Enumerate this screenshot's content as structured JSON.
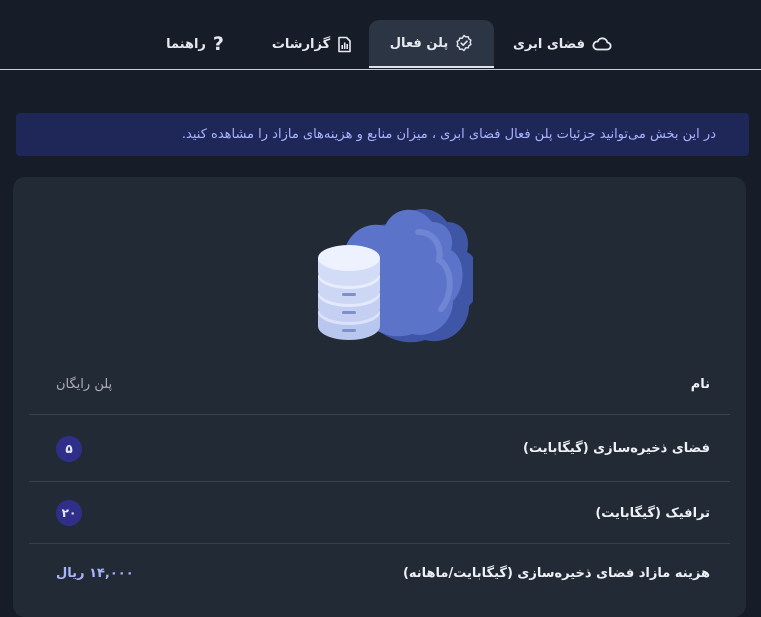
{
  "tabs": [
    {
      "label": "فضای ابری",
      "icon": "cloud-icon",
      "active": false
    },
    {
      "label": "پلن فعال",
      "icon": "check-badge-icon",
      "active": true
    },
    {
      "label": "گزارشات",
      "icon": "report-icon",
      "active": false
    },
    {
      "label": "راهنما",
      "icon": "question-icon",
      "active": false
    }
  ],
  "info_text": "در این بخش می‌توانید جزئیات پلن فعال فضای ابری ، میزان منابع و هزینه‌های مازاد را مشاهده کنید.",
  "plan": {
    "name_label": "نام",
    "name_value": "پلن رایگان",
    "storage_label": "فضای ذخیره‌سازی (گیگابایت)",
    "storage_value": "۵",
    "traffic_label": "ترافیک (گیگابایت)",
    "traffic_value": "۲۰",
    "extra_cost_label": "هزینه مازاد فضای ذخیره‌سازی (گیگابایت/ماهانه)",
    "extra_cost_value": "۱۴,۰۰۰ ریال"
  },
  "colors": {
    "background": "#161d29",
    "card": "#222a36",
    "active_tab": "#2c3544",
    "info_bg": "#1e2757",
    "accent_text": "#a9b4ff",
    "badge_bg": "#2f2f8a",
    "cloud": "#5b74c9"
  }
}
